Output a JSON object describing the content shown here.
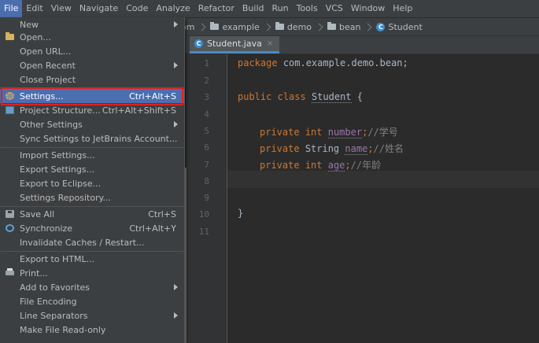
{
  "menubar": {
    "items": [
      "File",
      "Edit",
      "View",
      "Navigate",
      "Code",
      "Analyze",
      "Refactor",
      "Build",
      "Run",
      "Tools",
      "VCS",
      "Window",
      "Help"
    ]
  },
  "navbar": {
    "crumbs": [
      "om",
      "example",
      "demo",
      "bean",
      "Student"
    ]
  },
  "tab": {
    "label": "Student.java",
    "close": "×"
  },
  "editor": {
    "line_numbers": [
      "1",
      "2",
      "3",
      "4",
      "5",
      "6",
      "7",
      "8",
      "9",
      "10",
      "11"
    ],
    "pkg_kw": "package",
    "pkg_name": "com.example.demo.bean;",
    "class_kw1": "public",
    "class_kw2": "class",
    "class_name": "Student",
    "open_brace": "{",
    "close_brace": "}",
    "f1_mod": "private",
    "f1_type": "int",
    "f1_name": "number",
    "f1_comment": "//学号",
    "f2_mod": "private",
    "f2_type": "String",
    "f2_name": "name",
    "f2_comment": "//姓名",
    "f3_mod": "private",
    "f3_type": "int",
    "f3_name": "age",
    "f3_comment": "//年龄",
    "semicolon": ";"
  },
  "file_menu": {
    "new": "New",
    "open": "Open...",
    "open_url": "Open URL...",
    "open_recent": "Open Recent",
    "close_project": "Close Project",
    "settings": "Settings...",
    "settings_sc": "Ctrl+Alt+S",
    "project_structure": "Project Structure...",
    "project_structure_sc": "Ctrl+Alt+Shift+S",
    "other_settings": "Other Settings",
    "sync_settings": "Sync Settings to JetBrains Account...",
    "import_settings": "Import Settings...",
    "export_settings": "Export Settings...",
    "export_eclipse": "Export to Eclipse...",
    "settings_repo": "Settings Repository...",
    "save_all": "Save All",
    "save_all_sc": "Ctrl+S",
    "synchronize": "Synchronize",
    "synchronize_sc": "Ctrl+Alt+Y",
    "invalidate": "Invalidate Caches / Restart...",
    "export_html": "Export to HTML...",
    "print": "Print...",
    "add_favorites": "Add to Favorites",
    "file_encoding": "File Encoding",
    "line_separators": "Line Separators",
    "read_only": "Make File Read-only"
  }
}
